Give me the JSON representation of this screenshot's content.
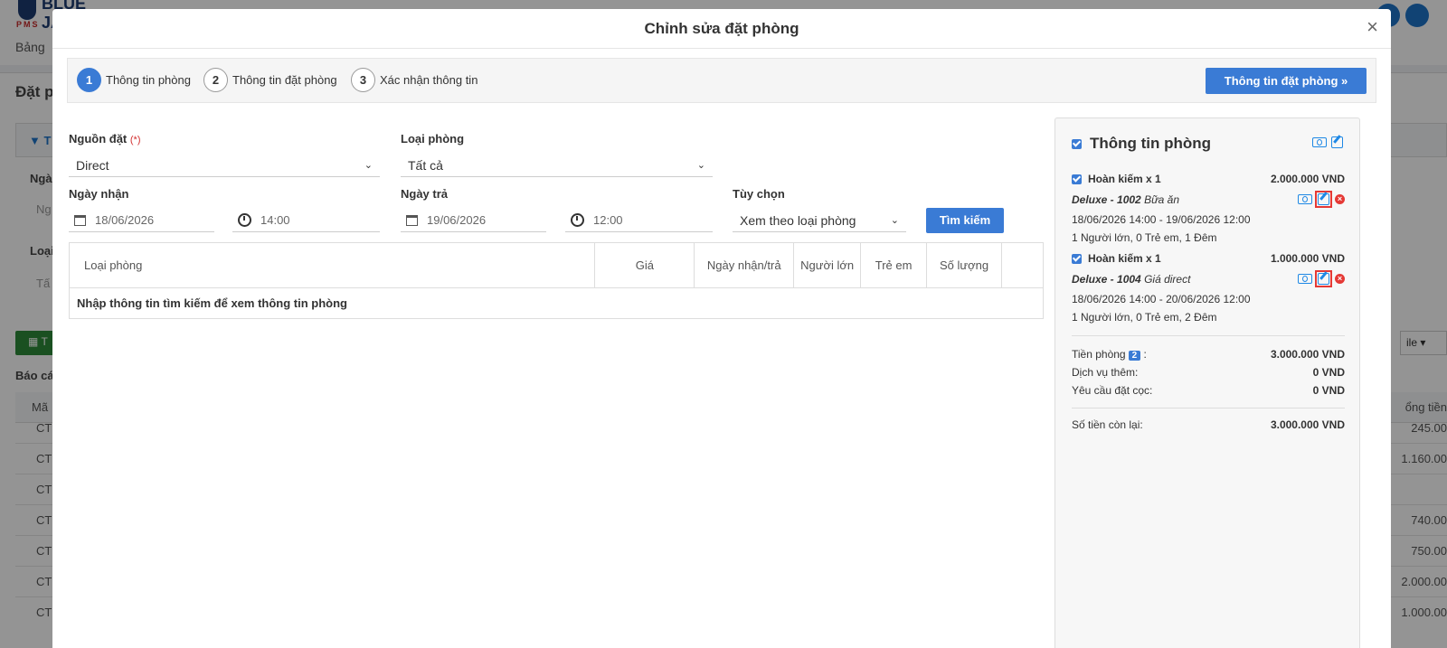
{
  "background": {
    "logo_text": "BLUE JAY",
    "logo_sub": "PMS",
    "nav_text": "Bảng",
    "page_title": "Đặt p",
    "filter_label": "T",
    "label_1": "Ngà",
    "value_1": "Ng",
    "label_2": "Loại",
    "value_2": "Tấ",
    "green_button": "T",
    "report_label": "Báo cá",
    "table_col_1": "Mã",
    "table_col_right": "ổng tiền",
    "rows_left": [
      "CT",
      "CT",
      "CT",
      "CT",
      "CT",
      "CT",
      "CT"
    ],
    "rows_right": [
      "245.00",
      "1.160.00",
      "",
      "740.00",
      "750.00",
      "2.000.00",
      "1.000.00"
    ],
    "right_button": "ile ▾"
  },
  "modal": {
    "title": "Chỉnh sửa đặt phòng",
    "close": "×",
    "steps": [
      {
        "num": "1",
        "label": "Thông tin phòng"
      },
      {
        "num": "2",
        "label": "Thông tin đặt phòng"
      },
      {
        "num": "3",
        "label": "Xác nhận thông tin"
      }
    ],
    "next_button": "Thông tin đặt phòng »",
    "form": {
      "source_label": "Nguồn đặt",
      "required_mark": "(*)",
      "source_value": "Direct",
      "room_type_label": "Loại phòng",
      "room_type_value": "Tất cả",
      "checkin_label": "Ngày nhận",
      "checkin_date": "18/06/2026",
      "checkin_time": "14:00",
      "checkout_label": "Ngày trả",
      "checkout_date": "19/06/2026",
      "checkout_time": "12:00",
      "option_label": "Tùy chọn",
      "option_value": "Xem theo loại phòng",
      "search_button": "Tìm kiếm"
    },
    "table": {
      "headers": [
        "Loại phòng",
        "Giá",
        "Ngày nhận/trả",
        "Người lớn",
        "Trẻ em",
        "Số lượng",
        ""
      ],
      "empty_message": "Nhập thông tin tìm kiếm để xem thông tin phòng"
    },
    "sidebar": {
      "title": "Thông tin phòng",
      "rooms": [
        {
          "name": "Hoàn kiếm x 1",
          "price": "2.000.000 VND",
          "room": "Deluxe - 1002",
          "rate": "Bữa ăn",
          "dates": "18/06/2026 14:00 - 19/06/2026 12:00",
          "guests": "1 Người lớn, 0 Trẻ em, 1 Đêm"
        },
        {
          "name": "Hoàn kiếm x 1",
          "price": "1.000.000 VND",
          "room": "Deluxe - 1004",
          "rate": "Giá direct",
          "dates": "18/06/2026 14:00 - 20/06/2026 12:00",
          "guests": "1 Người lớn, 0 Trẻ em, 2 Đêm"
        }
      ],
      "room_fee_label": "Tiền phòng",
      "room_fee_badge": "2",
      "room_fee_colon": ":",
      "room_fee": "3.000.000 VND",
      "service_label": "Dịch vụ thêm:",
      "service_fee": "0 VND",
      "deposit_label": "Yêu cầu đặt cọc:",
      "deposit_fee": "0 VND",
      "remaining_label": "Số tiền còn lại:",
      "remaining_fee": "3.000.000 VND"
    }
  }
}
